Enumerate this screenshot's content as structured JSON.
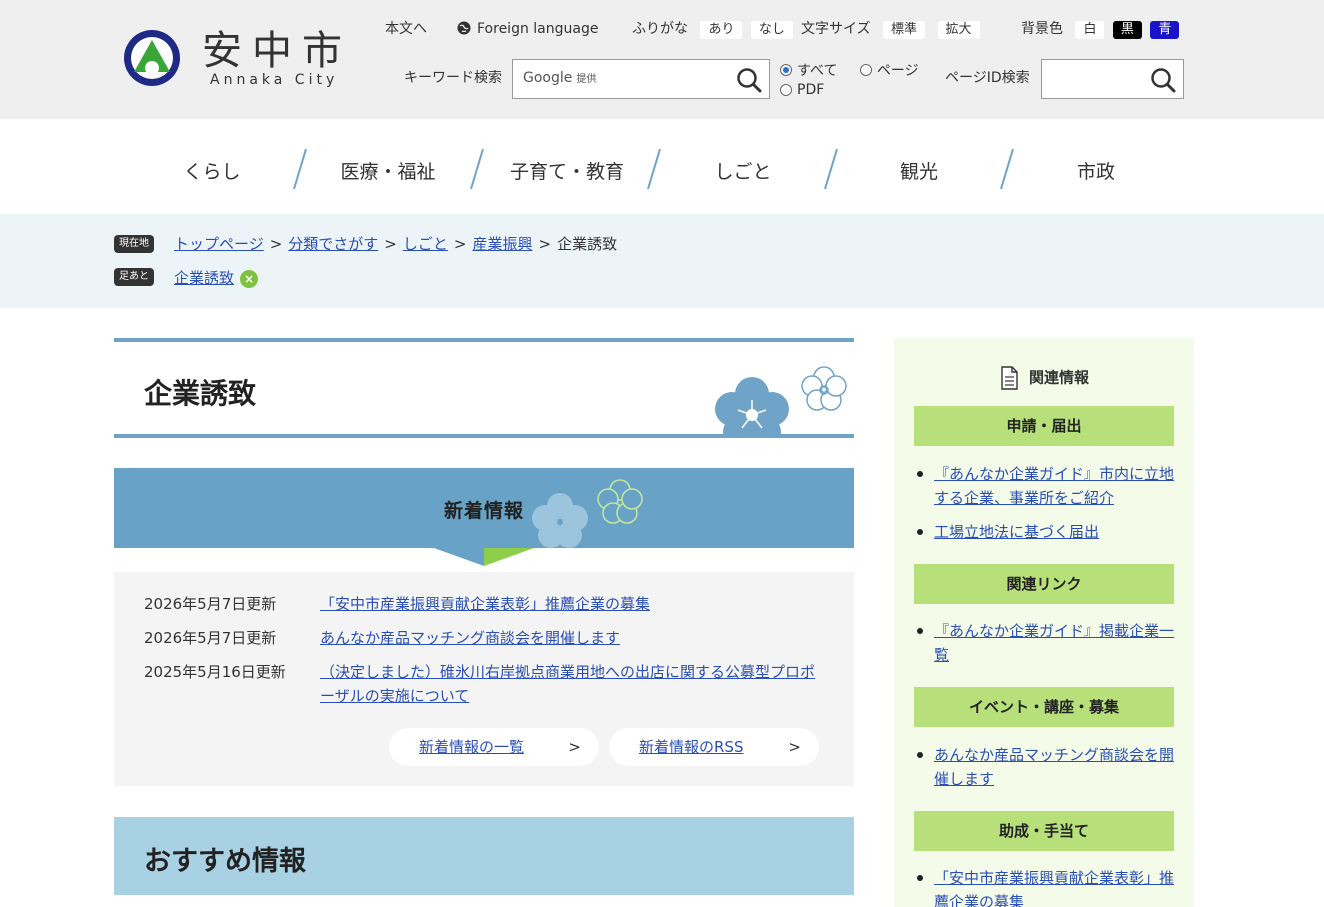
{
  "header": {
    "logo_title": "安中市",
    "logo_sub": "Annaka City",
    "skip_link": "本文へ",
    "foreign_language": "Foreign language",
    "furigana_label": "ふりがな",
    "furigana_on": "あり",
    "furigana_off": "なし",
    "fontsize_label": "文字サイズ",
    "fontsize_standard": "標準",
    "fontsize_large": "拡大",
    "bgcolor_label": "背景色",
    "bg_white": "白",
    "bg_black": "黒",
    "bg_blue": "青",
    "keyword_label": "キーワード検索",
    "google_mark": "Google",
    "google_sub": "提供",
    "radio_all": "すべて",
    "radio_page": "ページ",
    "radio_pdf": "PDF",
    "page_id_label": "ページID検索"
  },
  "gnav": [
    "くらし",
    "医療・福祉",
    "子育て・教育",
    "しごと",
    "観光",
    "市政"
  ],
  "breadcrumb": {
    "current_tag": "現在地",
    "history_tag": "足あと",
    "path": [
      "トップページ",
      "分類でさがす",
      "しごと",
      "産業振興"
    ],
    "current": "企業誘致",
    "history": "企業誘致",
    "history_close": "×"
  },
  "main": {
    "title": "企業誘致",
    "news_title": "新着情報",
    "news": [
      {
        "date": "2026年5月7日更新",
        "text": "「安中市産業振興貢献企業表彰」推薦企業の募集"
      },
      {
        "date": "2026年5月7日更新",
        "text": "あんなか産品マッチング商談会を開催します"
      },
      {
        "date": "2025年5月16日更新",
        "text": "（決定しました）碓氷川右岸拠点商業用地への出店に関する公募型プロポーザルの実施について"
      }
    ],
    "news_list_btn": "新着情報の一覧",
    "news_rss_btn": "新着情報のRSS",
    "chevron": ">",
    "recommend_title": "おすすめ情報"
  },
  "sidebar": {
    "title": "関連情報",
    "sections": [
      {
        "heading": "申請・届出",
        "links": [
          "『あんなか企業ガイド』市内に立地する企業、事業所をご紹介",
          "工場立地法に基づく届出"
        ]
      },
      {
        "heading": "関連リンク",
        "links": [
          "『あんなか企業ガイド』掲載企業一覧"
        ]
      },
      {
        "heading": "イベント・講座・募集",
        "links": [
          "あんなか産品マッチング商談会を開催します"
        ]
      },
      {
        "heading": "助成・手当て",
        "links": [
          "「安中市産業振興貢献企業表彰」推薦企業の募集"
        ]
      }
    ]
  },
  "colors": {
    "accent_blue": "#68a2c6",
    "accent_green": "#b8e07a",
    "link": "#2a4fb4"
  }
}
